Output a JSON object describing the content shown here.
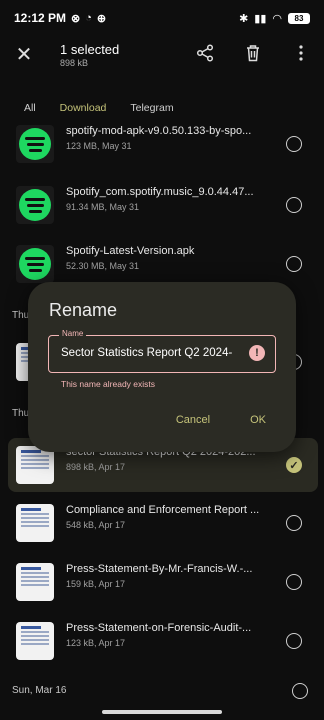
{
  "status": {
    "time": "12:12 PM",
    "battery": "83"
  },
  "app_bar": {
    "title": "1 selected",
    "subtitle": "898 kB"
  },
  "tabs": [
    "All",
    "Download",
    "Telegram"
  ],
  "files": [
    {
      "name": "spotify-mod-apk-v9.0.50.133-by-spo...",
      "meta": "123 MB, May 31",
      "thumb": "spotify",
      "selected": false
    },
    {
      "name": "Spotify_com.spotify.music_9.0.44.47...",
      "meta": "91.34 MB, May 31",
      "thumb": "spotify",
      "selected": false
    },
    {
      "name": "Spotify-Latest-Version.apk",
      "meta": "52.30 MB, May 31",
      "thumb": "spotify",
      "selected": false
    },
    {
      "name": "sector Statistics Report Q2 2024-202...",
      "meta": "898 kB, Apr 17",
      "thumb": "doc",
      "selected": true
    },
    {
      "name": "Compliance and Enforcement Report ...",
      "meta": "548 kB, Apr 17",
      "thumb": "doc",
      "selected": false
    },
    {
      "name": "Press-Statement-By-Mr.-Francis-W.-...",
      "meta": "159 kB, Apr 17",
      "thumb": "doc",
      "selected": false
    },
    {
      "name": "Press-Statement-on-Forensic-Audit-...",
      "meta": "123 kB, Apr 17",
      "thumb": "doc",
      "selected": false
    }
  ],
  "sections": {
    "thu1": "Thu",
    "thu2": "Thu",
    "last": "Sun, Mar 16"
  },
  "dialog": {
    "title": "Rename",
    "field_label": "Name",
    "field_value": "Sector Statistics Report Q2 2024-",
    "error": "This name already exists",
    "cancel": "Cancel",
    "ok": "OK"
  },
  "colors": {
    "accent": "#c5c37a",
    "error": "#f2b6b6",
    "dialog_bg": "#2b2b24"
  }
}
